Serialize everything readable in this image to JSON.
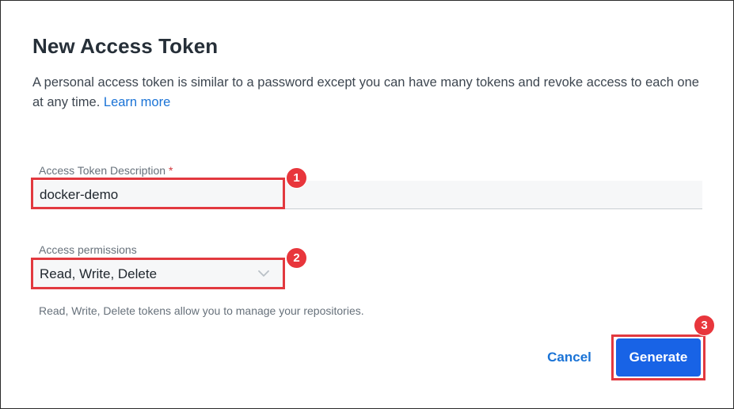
{
  "dialog": {
    "title": "New Access Token",
    "description": "A personal access token is similar to a password except you can have many tokens and revoke access to each one at any time.",
    "learn_more": "Learn more"
  },
  "fields": {
    "description_label": "Access Token Description",
    "required_marker": "*",
    "description_value": "docker-demo",
    "permissions_label": "Access permissions",
    "permissions_value": "Read, Write, Delete",
    "permissions_helper": "Read, Write, Delete tokens allow you to manage your repositories."
  },
  "actions": {
    "cancel_label": "Cancel",
    "generate_label": "Generate"
  },
  "annotations": {
    "step1": "1",
    "step2": "2",
    "step3": "3",
    "color": "#e2393f"
  },
  "colors": {
    "link": "#1a73d6",
    "primary_button": "#1863e6",
    "title": "#262f38"
  },
  "icons": {
    "permissions_dropdown": "chevron-down-icon"
  }
}
